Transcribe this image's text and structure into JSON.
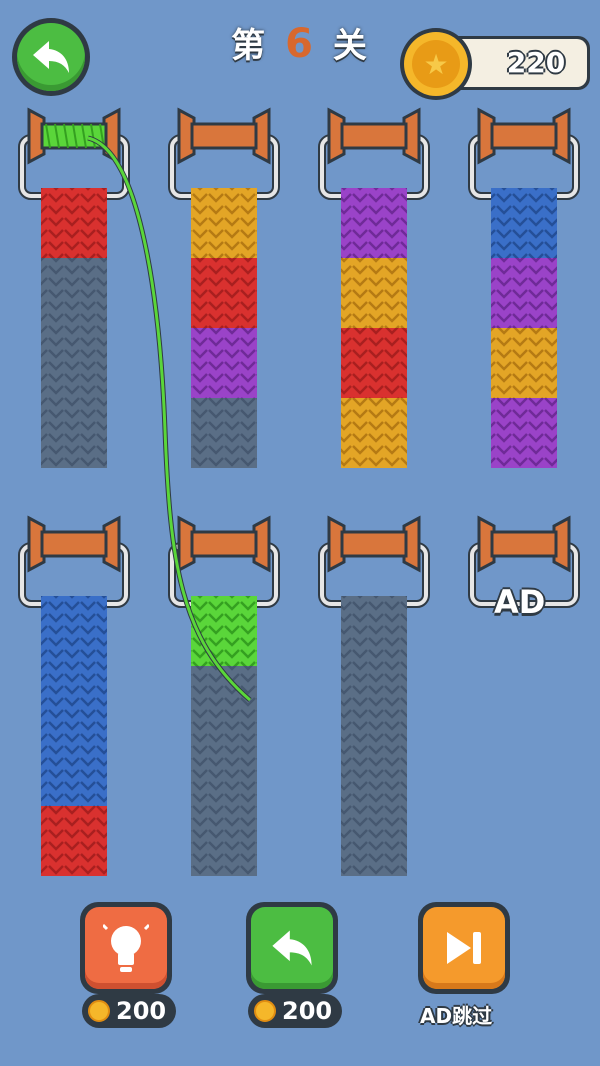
{
  "header": {
    "level_prefix": "第",
    "level_number": "6",
    "level_suffix": "关",
    "coins": "220"
  },
  "colors": {
    "background": "#7097c9",
    "red": "#d9312f",
    "gold": "#e3a526",
    "purple": "#9a43c8",
    "blue": "#3a6fc8",
    "green": "#5ad63a",
    "gray": "#5a6e86",
    "spool": "#d9763c"
  },
  "columns": [
    {
      "id": "col-1",
      "segments": [
        "red",
        "gray",
        "gray",
        "gray"
      ],
      "spool_wound": "green"
    },
    {
      "id": "col-2",
      "segments": [
        "gold",
        "red",
        "purple",
        "gray"
      ],
      "spool_wound": null
    },
    {
      "id": "col-3",
      "segments": [
        "purple",
        "gold",
        "red",
        "gold"
      ],
      "spool_wound": null
    },
    {
      "id": "col-4",
      "segments": [
        "blue",
        "purple",
        "gold",
        "purple"
      ],
      "spool_wound": null
    },
    {
      "id": "col-5",
      "segments": [
        "blue",
        "blue",
        "blue",
        "red"
      ],
      "spool_wound": null
    },
    {
      "id": "col-6",
      "segments": [
        "green",
        "gray",
        "gray",
        "gray"
      ],
      "spool_wound": null
    },
    {
      "id": "col-7",
      "segments": [
        "gray",
        "gray",
        "gray",
        "gray"
      ],
      "spool_wound": null
    },
    {
      "id": "col-8",
      "segments": [],
      "spool_wound": null,
      "locked_label": "AD"
    }
  ],
  "buttons": {
    "hint": {
      "icon": "lightbulb-icon",
      "price": "200",
      "color": "#ef6c43"
    },
    "undo": {
      "icon": "undo-arrow-icon",
      "price": "200",
      "color": "#4cbd42"
    },
    "skip": {
      "icon": "skip-forward-icon",
      "label": "AD跳过",
      "color": "#f59a2c"
    }
  }
}
